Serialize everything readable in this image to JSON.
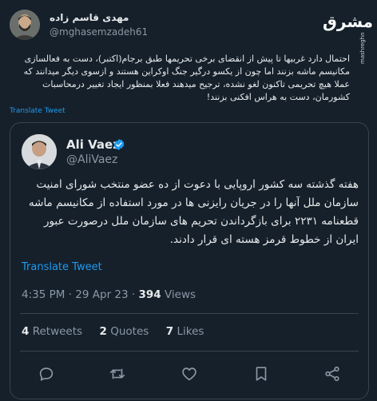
{
  "outer_tweet": {
    "display_name": "مهدی قاسم زاده",
    "handle": "@mghasemzadeh61",
    "text": "احتمال دارد غربیها تا پیش از انقضای برخی تحریمها طبق برجام(اکتبر)، دست به فعالسازی مکانیسم ماشه بزنند اما چون از یکسو درگیر جنگ اوکراین هستند و ازسوی دیگر میدانند که عملا هیچ تحریمی تاکنون لغو نشده، ترجیح میدهند فعلا بمنظور ایجاد تغییر درمحاسبات کشورمان، دست به هراس افکنی بزنند!",
    "translate_label": "Translate Tweet"
  },
  "watermark": {
    "brand": "مشرق",
    "site": "mashreghnews.ir"
  },
  "quoted_tweet": {
    "display_name": "Ali Vaez",
    "handle": "@AliVaez",
    "text": "هفته گذشته سه کشور اروپایی با دعوت از ده عضو منتخب شورای امنیت سازمان ملل آنها را در جریان رایزنی ها در مورد استفاده از مکانیسم ماشه قطعنامه ۲۲۳۱ برای بازگرداندن تحریم های سازمان ملل درصورت عبور ایران از خطوط قرمز هسته ای قرار دادند.",
    "translate_label": "Translate Tweet",
    "time": "4:35 PM",
    "date": "29 Apr 23",
    "sep": "·",
    "views_count": "394",
    "views_label": "Views",
    "retweets_count": "4",
    "retweets_label": "Retweets",
    "quotes_count": "2",
    "quotes_label": "Quotes",
    "likes_count": "7",
    "likes_label": "Likes"
  },
  "colors": {
    "background": "#15202b",
    "accent": "#1d9bf0",
    "text": "#e7e9ea",
    "muted": "#8b98a5",
    "border": "#38444d"
  },
  "icons": [
    "reply-icon",
    "retweet-icon",
    "like-icon",
    "bookmark-icon",
    "share-icon",
    "verified-badge-icon"
  ]
}
